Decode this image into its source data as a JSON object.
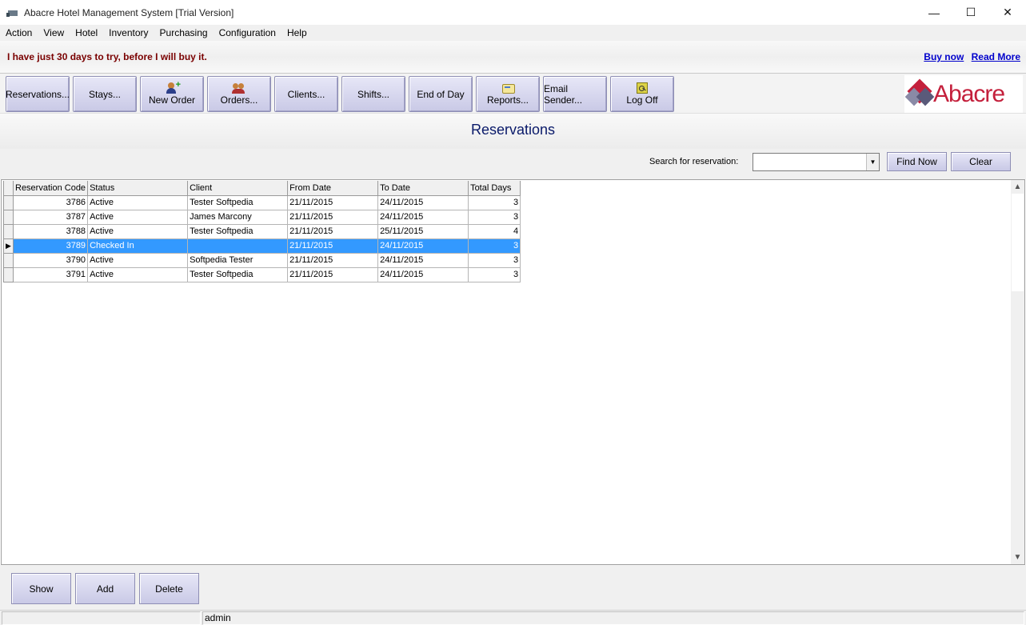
{
  "window": {
    "title": "Abacre Hotel Management System [Trial Version]",
    "controls": {
      "minimize": "—",
      "maximize": "☐",
      "close": "✕"
    }
  },
  "menu": [
    "Action",
    "View",
    "Hotel",
    "Inventory",
    "Purchasing",
    "Configuration",
    "Help"
  ],
  "banner": {
    "message": "I have just 30 days to try, before I will buy it.",
    "buy_now": "Buy now",
    "read_more": "Read More"
  },
  "toolbar": {
    "buttons": [
      {
        "label": "Reservations...",
        "icon": "none"
      },
      {
        "label": "Stays...",
        "icon": "none"
      },
      {
        "label": "New Order",
        "icon": "new-order-icon"
      },
      {
        "label": "Orders...",
        "icon": "orders-icon"
      },
      {
        "label": "Clients...",
        "icon": "none"
      },
      {
        "label": "Shifts...",
        "icon": "none"
      },
      {
        "label": "End of Day",
        "icon": "none"
      },
      {
        "label": "Reports...",
        "icon": "reports-icon"
      },
      {
        "label": "Email Sender...",
        "icon": "none"
      },
      {
        "label": "Log Off",
        "icon": "log-off-icon"
      }
    ],
    "logo_text": "Abacre"
  },
  "page": {
    "title": "Reservations",
    "search_label": "Search for reservation:",
    "search_value": "",
    "find_now": "Find Now",
    "clear": "Clear"
  },
  "grid": {
    "columns": [
      "Reservation Code",
      "Status",
      "Client",
      "From Date",
      "To Date",
      "Total Days"
    ],
    "rows": [
      {
        "code": "3786",
        "status": "Active",
        "client": "Tester Softpedia",
        "from": "21/11/2015",
        "to": "24/11/2015",
        "days": "3"
      },
      {
        "code": "3787",
        "status": "Active",
        "client": "James Marcony",
        "from": "21/11/2015",
        "to": "24/11/2015",
        "days": "3"
      },
      {
        "code": "3788",
        "status": "Active",
        "client": "Tester Softpedia",
        "from": "21/11/2015",
        "to": "25/11/2015",
        "days": "4"
      },
      {
        "code": "3789",
        "status": "Checked In",
        "client": "",
        "from": "21/11/2015",
        "to": "24/11/2015",
        "days": "3"
      },
      {
        "code": "3790",
        "status": "Active",
        "client": "Softpedia Tester",
        "from": "21/11/2015",
        "to": "24/11/2015",
        "days": "3"
      },
      {
        "code": "3791",
        "status": "Active",
        "client": "Tester Softpedia",
        "from": "21/11/2015",
        "to": "24/11/2015",
        "days": "3"
      }
    ],
    "selected_row_index": 3
  },
  "bottom_buttons": {
    "show": "Show",
    "add": "Add",
    "delete": "Delete"
  },
  "status": {
    "user": "admin"
  },
  "colors": {
    "selection": "#3399ff",
    "heading": "#0a1a6a",
    "banner_text": "#7a0000",
    "brand": "#c4203c"
  }
}
